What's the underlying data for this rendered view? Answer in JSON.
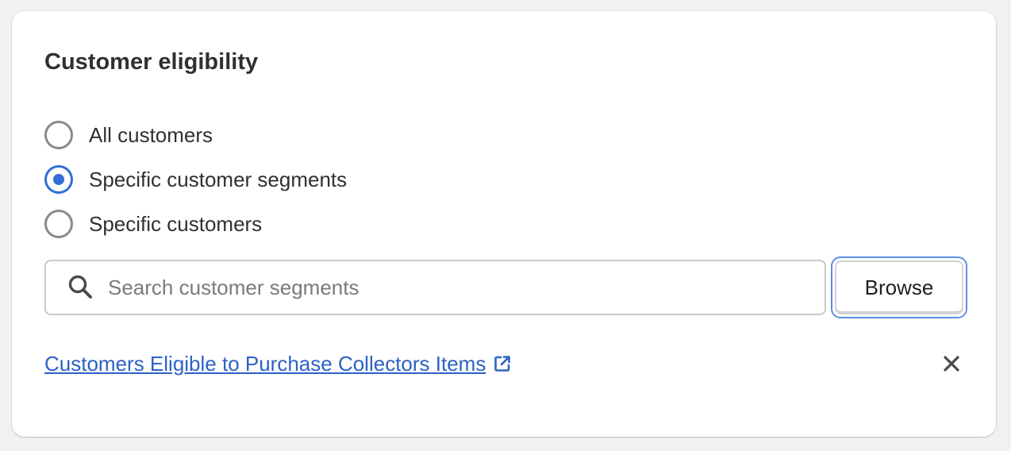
{
  "section": {
    "title": "Customer eligibility"
  },
  "eligibility_options": [
    {
      "label": "All customers",
      "checked": false
    },
    {
      "label": "Specific customer segments",
      "checked": true
    },
    {
      "label": "Specific customers",
      "checked": false
    }
  ],
  "search": {
    "placeholder": "Search customer segments",
    "value": "",
    "icon": "search-icon"
  },
  "browse": {
    "label": "Browse"
  },
  "selected_segment": {
    "label": "Customers Eligible to Purchase Collectors Items",
    "link_icon": "external-link-icon",
    "remove_icon": "close-icon"
  },
  "colors": {
    "accent": "#2f6fd6",
    "link": "#2c62c4",
    "focus_ring": "#5b8fe6",
    "background": "#f1f1f1",
    "card": "#ffffff"
  }
}
